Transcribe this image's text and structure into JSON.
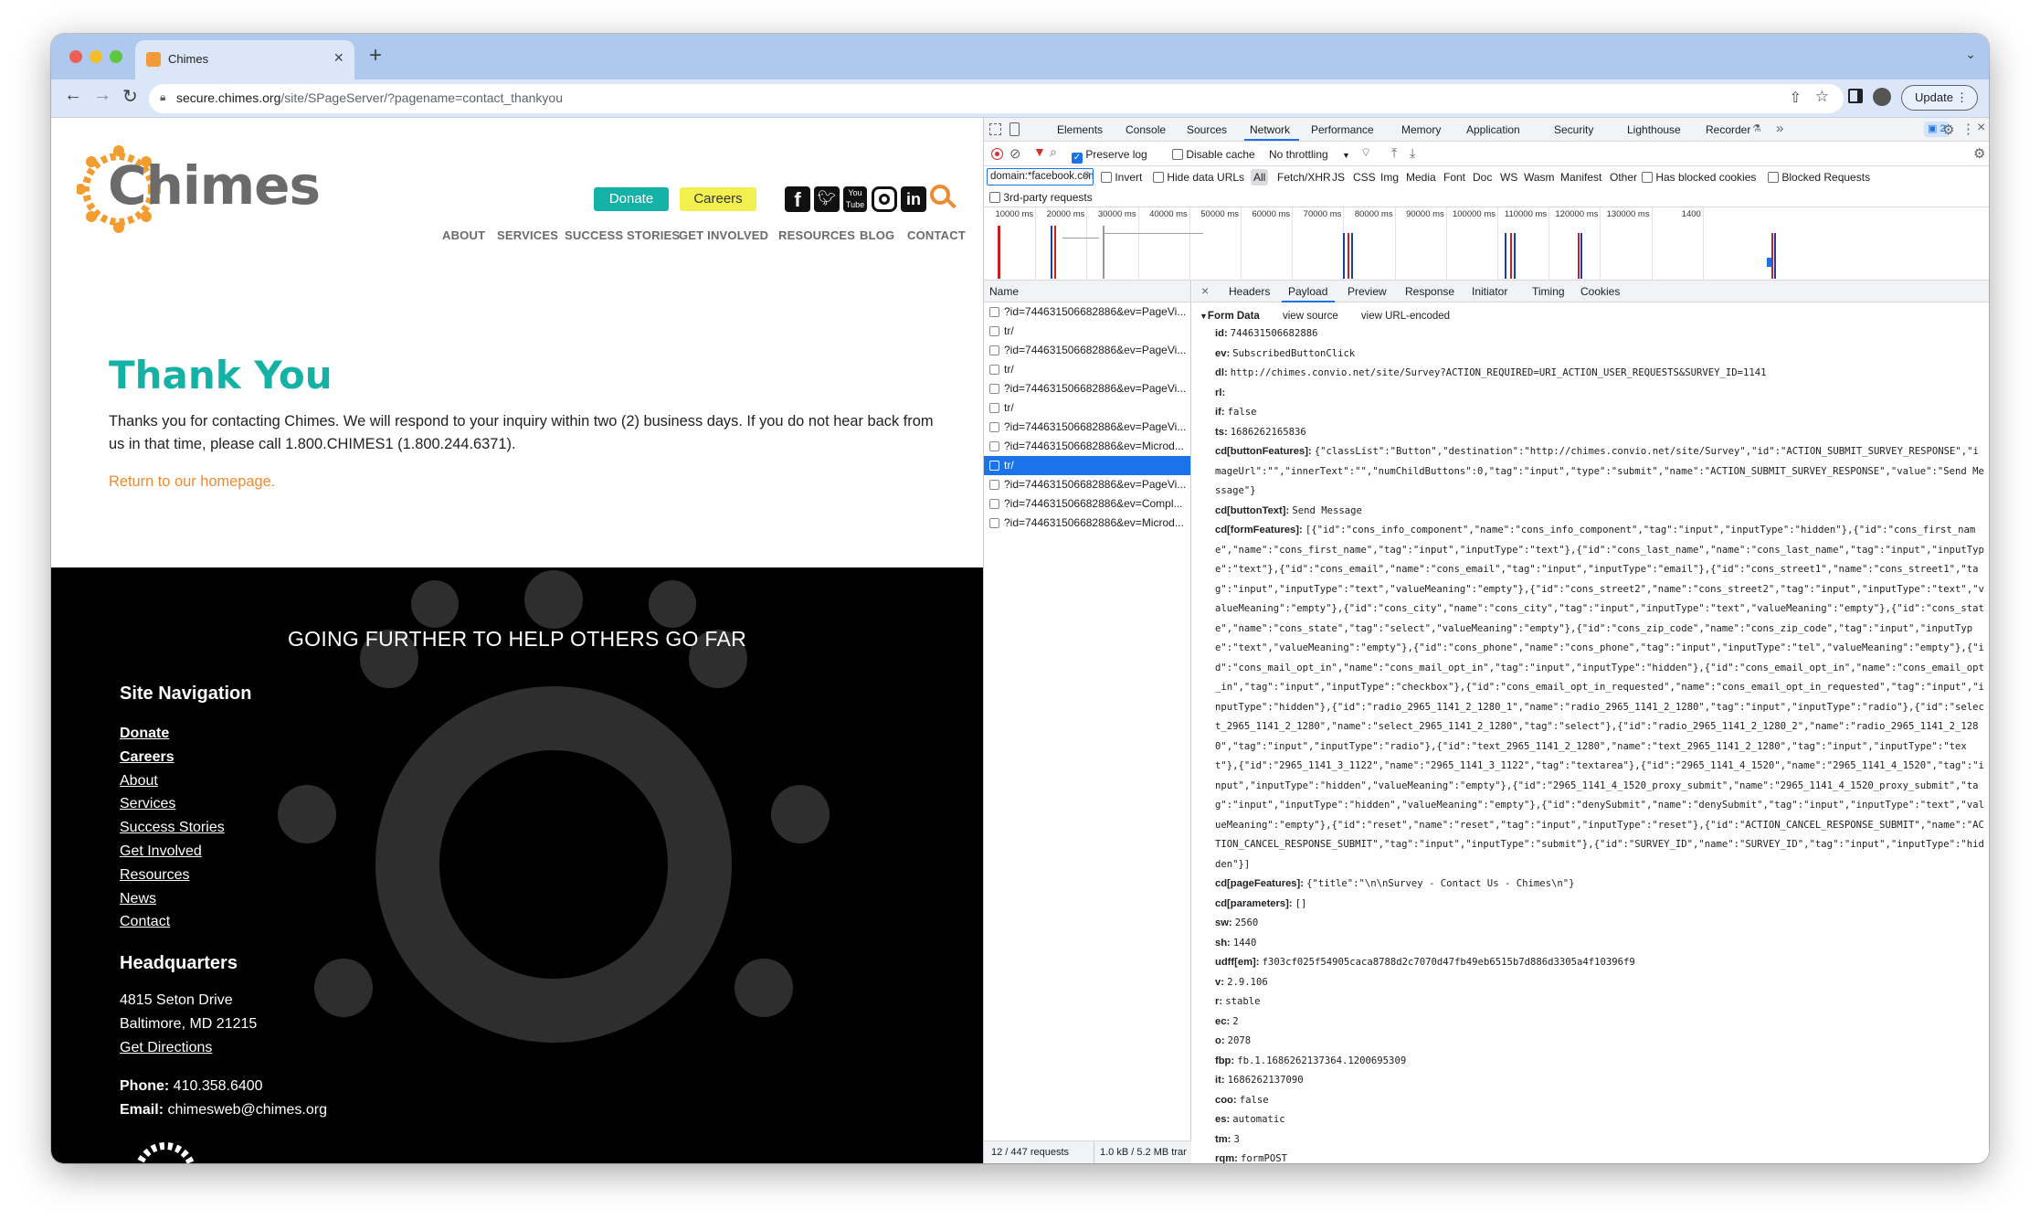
{
  "browser": {
    "tab_title": "Chimes",
    "url_host": "secure.chimes.org",
    "url_path": "/site/SPageServer/?pagename=contact_thankyou",
    "update_label": "Update"
  },
  "site": {
    "logo_text": "Chimes",
    "donate_label": "Donate",
    "careers_label": "Careers",
    "nav": [
      "ABOUT",
      "SERVICES",
      "SUCCESS STORIES",
      "GET INVOLVED",
      "RESOURCES",
      "BLOG",
      "CONTACT"
    ],
    "heading": "Thank You",
    "body_line1": "Thanks you for contacting Chimes. We will respond to your inquiry within two (2) business days. If you do not hear back from",
    "body_line2": "us in that time, please call 1.800.CHIMES1 (1.800.244.6371).",
    "homepage_link": "Return to our homepage.",
    "footer_tagline": "GOING FURTHER TO HELP OTHERS GO FAR",
    "sitenav_heading": "Site Navigation",
    "footer_links": [
      "Donate",
      "Careers",
      "About",
      "Services",
      "Success Stories",
      "Get Involved",
      "Resources",
      "News",
      "Contact"
    ],
    "hq_heading": "Headquarters",
    "hq_line1": "4815 Seton Drive",
    "hq_line2": "Baltimore, MD 21215",
    "hq_directions": "Get Directions",
    "phone_label": "Phone:",
    "phone_value": "410.358.6400",
    "email_label": "Email:",
    "email_value": "chimesweb@chimes.org",
    "colors": {
      "teal": "#14b2a6",
      "orange": "#ef8a2f",
      "yellow": "#f2f04f",
      "grey": "#6b6b6b"
    }
  },
  "devtools": {
    "tabs": [
      "Elements",
      "Console",
      "Sources",
      "Network",
      "Performance",
      "Memory",
      "Application",
      "Security",
      "Lighthouse",
      "Recorder"
    ],
    "active_tab": "Network",
    "issues_badge": "2",
    "preserve_log": "Preserve log",
    "disable_cache": "Disable cache",
    "throttling": "No throttling",
    "filter_value": "domain:*facebook.com",
    "invert": "Invert",
    "hide_data_urls": "Hide data URLs",
    "type_filters": [
      "All",
      "Fetch/XHR",
      "JS",
      "CSS",
      "Img",
      "Media",
      "Font",
      "Doc",
      "WS",
      "Wasm",
      "Manifest",
      "Other"
    ],
    "has_blocked_cookies": "Has blocked cookies",
    "blocked_requests": "Blocked Requests",
    "third_party": "3rd-party requests",
    "timeline_ticks": [
      "10000 ms",
      "20000 ms",
      "30000 ms",
      "40000 ms",
      "50000 ms",
      "60000 ms",
      "70000 ms",
      "80000 ms",
      "90000 ms",
      "100000 ms",
      "110000 ms",
      "120000 ms",
      "130000 ms",
      "1400"
    ],
    "name_header": "Name",
    "requests": [
      "?id=744631506682886&ev=PageVi...",
      "tr/",
      "?id=744631506682886&ev=PageVi...",
      "tr/",
      "?id=744631506682886&ev=PageVi...",
      "tr/",
      "?id=744631506682886&ev=PageVi...",
      "?id=744631506682886&ev=Microd...",
      "tr/",
      "?id=744631506682886&ev=PageVi...",
      "?id=744631506682886&ev=Compl...",
      "?id=744631506682886&ev=Microd..."
    ],
    "selected_request_index": 8,
    "status_requests": "12 / 447 requests",
    "status_transferred": "1.0 kB / 5.2 MB trar",
    "detail_tabs": [
      "Headers",
      "Payload",
      "Preview",
      "Response",
      "Initiator",
      "Timing",
      "Cookies"
    ],
    "active_detail_tab": "Payload",
    "form_data_label": "Form Data",
    "view_source": "view source",
    "view_url_encoded": "view URL-encoded",
    "payload": [
      {
        "k": "id:",
        "v": "744631506682886"
      },
      {
        "k": "ev:",
        "v": "SubscribedButtonClick"
      },
      {
        "k": "dl:",
        "v": "http://chimes.convio.net/site/Survey?ACTION_REQUIRED=URI_ACTION_USER_REQUESTS&SURVEY_ID=1141"
      },
      {
        "k": "rl:",
        "v": ""
      },
      {
        "k": "if:",
        "v": "false"
      },
      {
        "k": "ts:",
        "v": "1686262165836"
      },
      {
        "k": "cd[buttonFeatures]:",
        "v": "{\"classList\":\"Button\",\"destination\":\"http://chimes.convio.net/site/Survey\",\"id\":\"ACTION_SUBMIT_SURVEY_RESPONSE\",\"imageUrl\":\"\",\"innerText\":\"\",\"numChildButtons\":0,\"tag\":\"input\",\"type\":\"submit\",\"name\":\"ACTION_SUBMIT_SURVEY_RESPONSE\",\"value\":\"Send Message\"}"
      },
      {
        "k": "cd[buttonText]:",
        "v": "Send Message"
      },
      {
        "k": "cd[formFeatures]:",
        "v": "[{\"id\":\"cons_info_component\",\"name\":\"cons_info_component\",\"tag\":\"input\",\"inputType\":\"hidden\"},{\"id\":\"cons_first_name\",\"name\":\"cons_first_name\",\"tag\":\"input\",\"inputType\":\"text\"},{\"id\":\"cons_last_name\",\"name\":\"cons_last_name\",\"tag\":\"input\",\"inputType\":\"text\"},{\"id\":\"cons_email\",\"name\":\"cons_email\",\"tag\":\"input\",\"inputType\":\"email\"},{\"id\":\"cons_street1\",\"name\":\"cons_street1\",\"tag\":\"input\",\"inputType\":\"text\",\"valueMeaning\":\"empty\"},{\"id\":\"cons_street2\",\"name\":\"cons_street2\",\"tag\":\"input\",\"inputType\":\"text\",\"valueMeaning\":\"empty\"},{\"id\":\"cons_city\",\"name\":\"cons_city\",\"tag\":\"input\",\"inputType\":\"text\",\"valueMeaning\":\"empty\"},{\"id\":\"cons_state\",\"name\":\"cons_state\",\"tag\":\"select\",\"valueMeaning\":\"empty\"},{\"id\":\"cons_zip_code\",\"name\":\"cons_zip_code\",\"tag\":\"input\",\"inputType\":\"text\",\"valueMeaning\":\"empty\"},{\"id\":\"cons_phone\",\"name\":\"cons_phone\",\"tag\":\"input\",\"inputType\":\"tel\",\"valueMeaning\":\"empty\"},{\"id\":\"cons_mail_opt_in\",\"name\":\"cons_mail_opt_in\",\"tag\":\"input\",\"inputType\":\"hidden\"},{\"id\":\"cons_email_opt_in\",\"name\":\"cons_email_opt_in\",\"tag\":\"input\",\"inputType\":\"checkbox\"},{\"id\":\"cons_email_opt_in_requested\",\"name\":\"cons_email_opt_in_requested\",\"tag\":\"input\",\"inputType\":\"hidden\"},{\"id\":\"radio_2965_1141_2_1280_1\",\"name\":\"radio_2965_1141_2_1280\",\"tag\":\"input\",\"inputType\":\"radio\"},{\"id\":\"select_2965_1141_2_1280\",\"name\":\"select_2965_1141_2_1280\",\"tag\":\"select\"},{\"id\":\"radio_2965_1141_2_1280_2\",\"name\":\"radio_2965_1141_2_1280\",\"tag\":\"input\",\"inputType\":\"radio\"},{\"id\":\"text_2965_1141_2_1280\",\"name\":\"text_2965_1141_2_1280\",\"tag\":\"input\",\"inputType\":\"text\"},{\"id\":\"2965_1141_3_1122\",\"name\":\"2965_1141_3_1122\",\"tag\":\"textarea\"},{\"id\":\"2965_1141_4_1520\",\"name\":\"2965_1141_4_1520\",\"tag\":\"input\",\"inputType\":\"hidden\",\"valueMeaning\":\"empty\"},{\"id\":\"2965_1141_4_1520_proxy_submit\",\"name\":\"2965_1141_4_1520_proxy_submit\",\"tag\":\"input\",\"inputType\":\"hidden\",\"valueMeaning\":\"empty\"},{\"id\":\"denySubmit\",\"name\":\"denySubmit\",\"tag\":\"input\",\"inputType\":\"text\",\"valueMeaning\":\"empty\"},{\"id\":\"reset\",\"name\":\"reset\",\"tag\":\"input\",\"inputType\":\"reset\"},{\"id\":\"ACTION_CANCEL_RESPONSE_SUBMIT\",\"name\":\"ACTION_CANCEL_RESPONSE_SUBMIT\",\"tag\":\"input\",\"inputType\":\"submit\"},{\"id\":\"SURVEY_ID\",\"name\":\"SURVEY_ID\",\"tag\":\"input\",\"inputType\":\"hidden\"}]"
      },
      {
        "k": "cd[pageFeatures]:",
        "v": "{\"title\":\"\\n\\nSurvey - Contact Us - Chimes\\n\"}"
      },
      {
        "k": "cd[parameters]:",
        "v": "[]"
      },
      {
        "k": "sw:",
        "v": "2560"
      },
      {
        "k": "sh:",
        "v": "1440"
      },
      {
        "k": "udff[em]:",
        "v": "f303cf025f54905caca8788d2c7070d47fb49eb6515b7d886d3305a4f10396f9"
      },
      {
        "k": "v:",
        "v": "2.9.106"
      },
      {
        "k": "r:",
        "v": "stable"
      },
      {
        "k": "ec:",
        "v": "2"
      },
      {
        "k": "o:",
        "v": "2078"
      },
      {
        "k": "fbp:",
        "v": "fb.1.1686262137364.1200695309"
      },
      {
        "k": "it:",
        "v": "1686262137090"
      },
      {
        "k": "coo:",
        "v": "false"
      },
      {
        "k": "es:",
        "v": "automatic"
      },
      {
        "k": "tm:",
        "v": "3"
      },
      {
        "k": "rqm:",
        "v": "formPOST"
      }
    ]
  }
}
